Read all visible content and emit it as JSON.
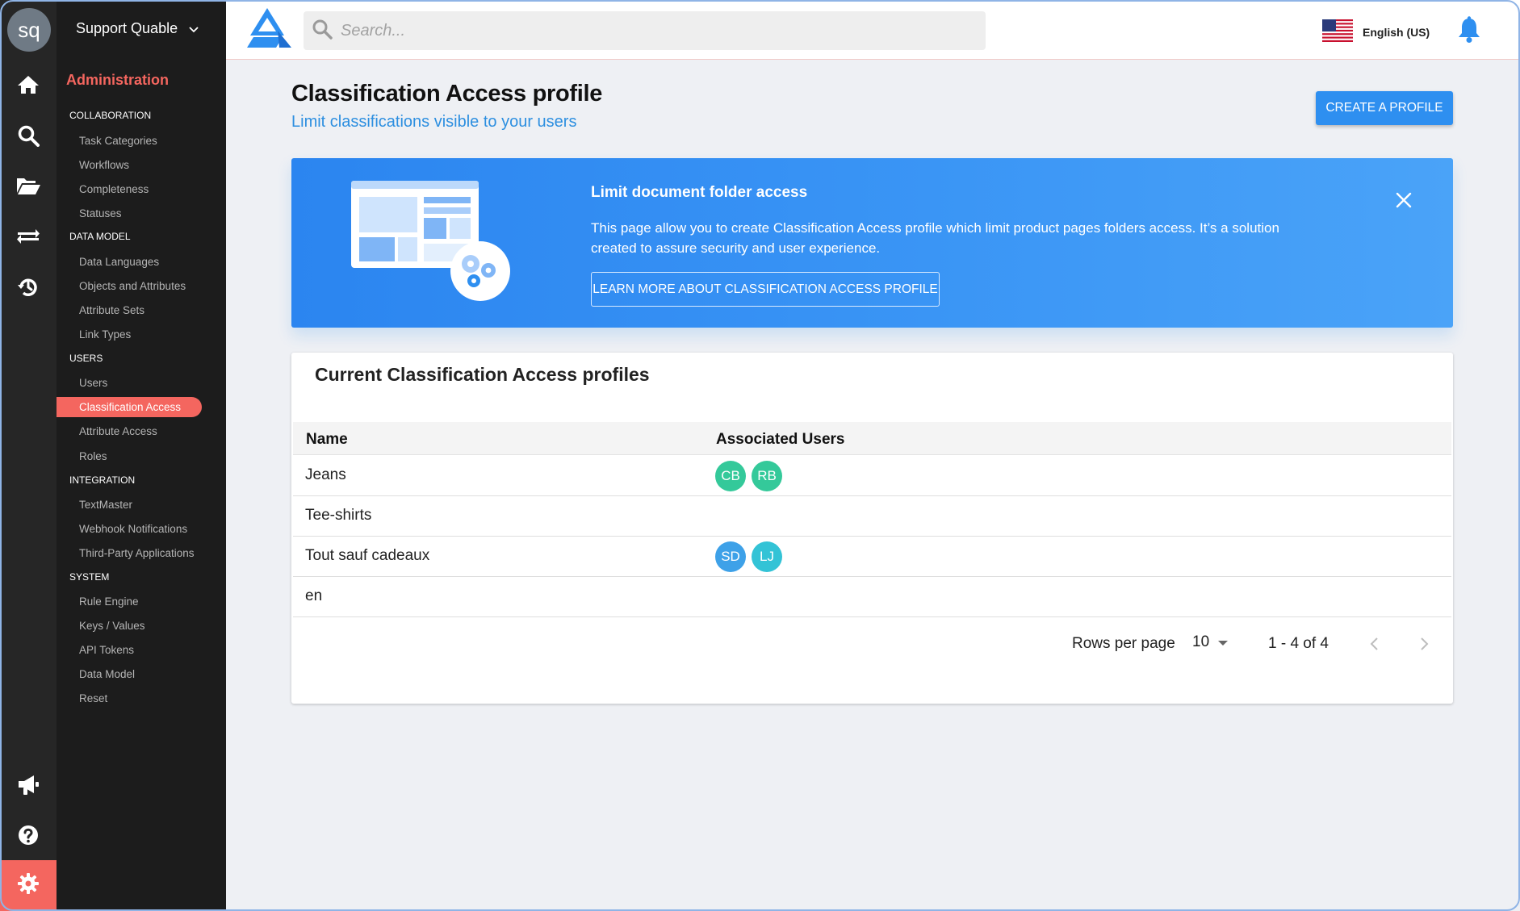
{
  "user": {
    "initials": "sq",
    "org_name": "Support Quable"
  },
  "rail": {
    "icons": [
      "home-icon",
      "search-icon",
      "folder-icon",
      "transfer-icon",
      "history-icon",
      "megaphone-icon",
      "help-icon",
      "gear-icon"
    ]
  },
  "sidebar": {
    "heading": "Administration",
    "sections": {
      "collaboration": "COLLABORATION",
      "data_model": "DATA MODEL",
      "users": "USERS",
      "integration": "INTEGRATION",
      "system": "SYSTEM"
    },
    "items": {
      "task_categories": "Task Categories",
      "workflows": "Workflows",
      "completeness": "Completeness",
      "statuses": "Statuses",
      "data_languages": "Data Languages",
      "objects_attributes": "Objects and Attributes",
      "attribute_sets": "Attribute Sets",
      "link_types": "Link Types",
      "users": "Users",
      "classification_access": "Classification Access",
      "attribute_access": "Attribute Access",
      "roles": "Roles",
      "textmaster": "TextMaster",
      "webhook_notifications": "Webhook Notifications",
      "third_party_apps": "Third-Party Applications",
      "rule_engine": "Rule Engine",
      "keys_values": "Keys / Values",
      "api_tokens": "API Tokens",
      "data_model": "Data Model",
      "reset": "Reset"
    },
    "active_item": "Classification Access"
  },
  "header": {
    "search_placeholder": "Search...",
    "language": "English (US)"
  },
  "page": {
    "title": "Classification Access profile",
    "subtitle": "Limit classifications visible to your users",
    "create_button": "CREATE A PROFILE"
  },
  "banner": {
    "title": "Limit document folder access",
    "text": "This page allow you to create Classification Access profile which limit product pages folders access. It’s a solution created to assure security and user experience.",
    "button": "LEARN MORE ABOUT CLASSIFICATION ACCESS PROFILE"
  },
  "table": {
    "title": "Current Classification Access profiles",
    "columns": [
      "Name",
      "Associated Users"
    ],
    "rows": [
      {
        "name": "Jeans",
        "users": [
          {
            "initials": "CB",
            "color": "#34c99a"
          },
          {
            "initials": "RB",
            "color": "#34c99a"
          }
        ]
      },
      {
        "name": "Tee-shirts",
        "users": []
      },
      {
        "name": "Tout sauf cadeaux",
        "users": [
          {
            "initials": "SD",
            "color": "#3ea1e8"
          },
          {
            "initials": "LJ",
            "color": "#33c3d6"
          }
        ]
      },
      {
        "name": "en",
        "users": []
      }
    ],
    "pagination": {
      "rows_per_page_label": "Rows per page",
      "rows_per_page": "10",
      "range": "1 - 4 of 4"
    }
  },
  "colors": {
    "accent": "#f4665f",
    "primary": "#2e8ff0",
    "sidebar_bg": "#1c1c1c"
  }
}
